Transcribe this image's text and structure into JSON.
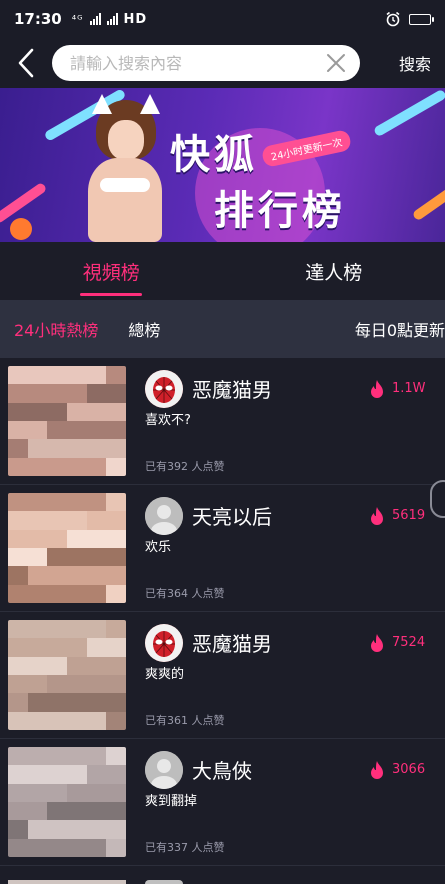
{
  "status_bar": {
    "time": "17:30",
    "network": "HD",
    "icons": [
      "signal-icon",
      "signal-icon",
      "hd-icon",
      "alarm-icon",
      "battery-icon"
    ],
    "battery_level": 0.6
  },
  "search": {
    "back_icon": "chevron-left-icon",
    "placeholder": "請輸入搜索內容",
    "value": "",
    "clear_icon": "close-icon",
    "button_label": "搜索"
  },
  "banner": {
    "title_line1": "快狐",
    "title_line2": "排行榜",
    "tag": "24小时更新一次"
  },
  "tabs": [
    {
      "label": "視頻榜",
      "active": true
    },
    {
      "label": "達人榜",
      "active": false
    }
  ],
  "subtabs": [
    {
      "label": "24小時熱榜",
      "active": true
    },
    {
      "label": "總榜",
      "active": false
    }
  ],
  "update_note": "每日0點更新",
  "items": [
    {
      "name": "恶魔猫男",
      "caption": "喜欢不?",
      "heat": "1.1W",
      "likes": "已有392 人点赞",
      "avatar": "spiderman-avatar"
    },
    {
      "name": "天亮以后",
      "caption": "欢乐",
      "heat": "5619",
      "likes": "已有364 人点赞",
      "avatar": "default-avatar"
    },
    {
      "name": "恶魔猫男",
      "caption": "爽爽的",
      "heat": "7524",
      "likes": "已有361 人点赞",
      "avatar": "spiderman-avatar"
    },
    {
      "name": "大鳥俠",
      "caption": "爽到翻掉",
      "heat": "3066",
      "likes": "已有337 人点赞",
      "avatar": "default-avatar"
    }
  ],
  "colors": {
    "accent": "#ff2f7c",
    "background": "#1c1d28",
    "subtab_bar": "#2e3140"
  }
}
